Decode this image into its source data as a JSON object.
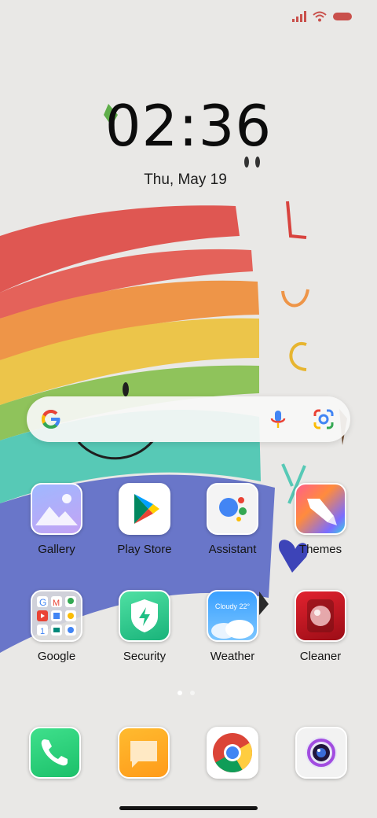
{
  "status_bar": {
    "icons": [
      "signal-icon",
      "wifi-icon",
      "battery-icon"
    ],
    "battery_color": "#c9504b"
  },
  "clock": {
    "time": "02:36",
    "date": "Thu, May 19"
  },
  "wallpaper": {
    "letters": [
      "L",
      "u",
      "c",
      "y"
    ],
    "rainbow_colors": [
      "#df5752",
      "#ee9548",
      "#ecc54a",
      "#8fc35b",
      "#57c9b6",
      "#6976c9"
    ]
  },
  "search_bar": {
    "icons": [
      "google-logo-icon",
      "microphone-icon",
      "google-lens-icon"
    ]
  },
  "apps": [
    {
      "name": "gallery",
      "label": "Gallery"
    },
    {
      "name": "play-store",
      "label": "Play Store"
    },
    {
      "name": "assistant",
      "label": "Assistant"
    },
    {
      "name": "themes",
      "label": "Themes"
    },
    {
      "name": "google-folder",
      "label": "Google"
    },
    {
      "name": "security",
      "label": "Security"
    },
    {
      "name": "weather",
      "label": "Weather",
      "widget_text": "Cloudy 22°"
    },
    {
      "name": "cleaner",
      "label": "Cleaner"
    }
  ],
  "page_indicator": {
    "pages": 2,
    "current": 1
  },
  "dock": [
    {
      "name": "phone",
      "icon": "phone-icon"
    },
    {
      "name": "messages",
      "icon": "message-icon"
    },
    {
      "name": "chrome",
      "icon": "chrome-icon"
    },
    {
      "name": "camera",
      "icon": "camera-icon"
    }
  ]
}
